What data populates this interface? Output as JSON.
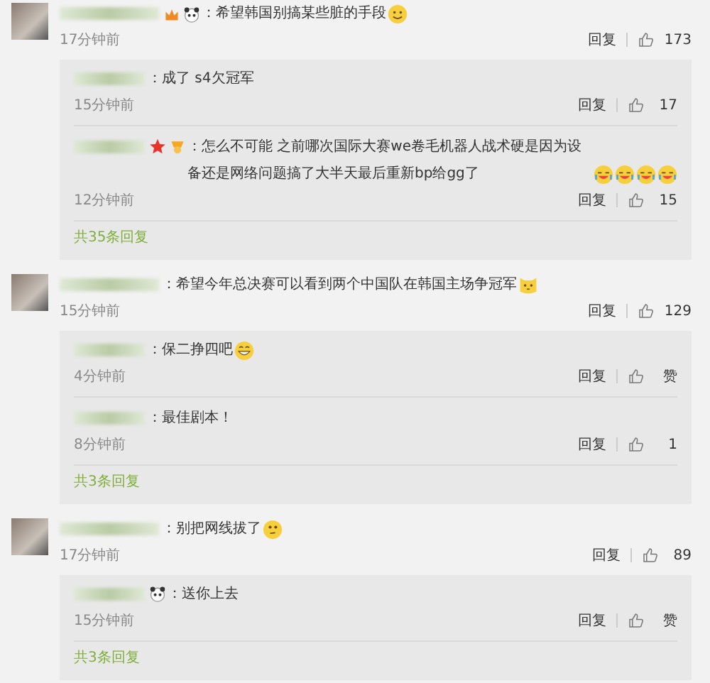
{
  "comments": [
    {
      "badges": [
        {
          "kind": "vip"
        },
        {
          "kind": "panda"
        }
      ],
      "text": "：希望韩国别搞某些脏的手段",
      "emojis": [
        {
          "kind": "smile"
        }
      ],
      "time": "17分钟前",
      "reply_label": "回复",
      "likes": "173",
      "replies": [
        {
          "text": "：成了 s4欠冠军",
          "time": "15分钟前",
          "reply_label": "回复",
          "likes": "17"
        },
        {
          "badges": [
            {
              "kind": "star"
            },
            {
              "kind": "medal"
            }
          ],
          "text": "：怎么不可能 之前哪次国际大赛we卷毛机器人战术硬是因为设备还是网络问题搞了大半天最后重新bp给gg了",
          "emojis": [
            {
              "kind": "cry"
            },
            {
              "kind": "cry"
            },
            {
              "kind": "cry"
            },
            {
              "kind": "cry"
            }
          ],
          "time": "12分钟前",
          "reply_label": "回复",
          "likes": "15"
        }
      ],
      "more": "共35条回复"
    },
    {
      "text": "：希望今年总决赛可以看到两个中国队在韩国主场争冠军",
      "emojis": [
        {
          "kind": "cat"
        }
      ],
      "time": "15分钟前",
      "reply_label": "回复",
      "likes": "129",
      "replies": [
        {
          "text": "：保二挣四吧",
          "emojis": [
            {
              "kind": "grin"
            }
          ],
          "time": "4分钟前",
          "reply_label": "回复",
          "likes": "赞"
        },
        {
          "text": "：最佳剧本！",
          "time": "8分钟前",
          "reply_label": "回复",
          "likes": "1"
        }
      ],
      "more": "共3条回复"
    },
    {
      "text": "：别把网线拔了",
      "emojis": [
        {
          "kind": "thinking"
        }
      ],
      "time": "17分钟前",
      "reply_label": "回复",
      "likes": "89",
      "replies": [
        {
          "badges": [
            {
              "kind": "panda"
            }
          ],
          "text": "：送你上去",
          "time": "15分钟前",
          "reply_label": "回复",
          "likes": "赞"
        }
      ],
      "more": "共3条回复"
    }
  ]
}
